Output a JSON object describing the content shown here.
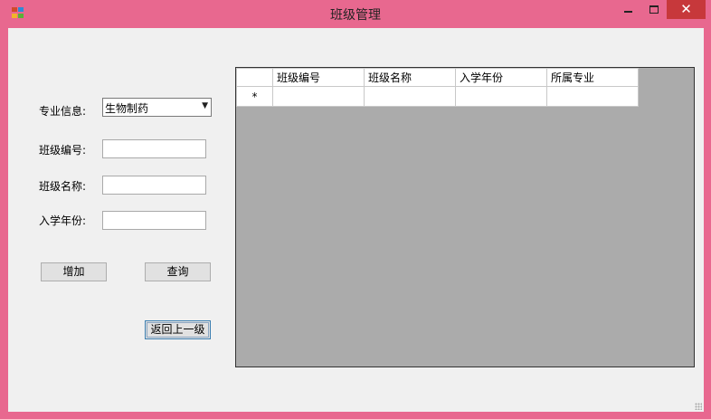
{
  "window": {
    "title": "班级管理"
  },
  "colors": {
    "frame": "#e8688f",
    "close": "#c7383b",
    "client": "#f0f0f0",
    "grid_bg": "#ababab"
  },
  "icons": {
    "app": "app-icon",
    "minimize": "minimize-icon",
    "maximize": "maximize-icon",
    "close": "close-icon"
  },
  "form": {
    "major_label": "专业信息:",
    "major_value": "生物制药",
    "class_no_label": "班级编号:",
    "class_no_value": "",
    "class_name_label": "班级名称:",
    "class_name_value": "",
    "year_label": "入学年份:",
    "year_value": ""
  },
  "buttons": {
    "add": "增加",
    "query": "查询",
    "back": "返回上一级"
  },
  "grid": {
    "columns": [
      "班级编号",
      "班级名称",
      "入学年份",
      "所属专业"
    ],
    "new_row_marker": "*"
  }
}
